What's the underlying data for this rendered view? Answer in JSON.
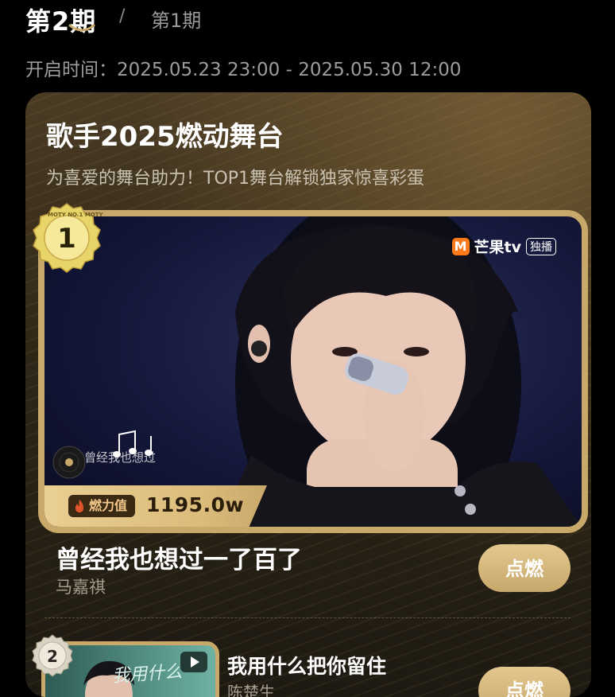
{
  "tabs": {
    "active": "第2期",
    "separator": "/",
    "other": "第1期"
  },
  "open_time": {
    "label": "开启时间：",
    "value": "2025.05.23 23:00 - 2025.05.30 12:00"
  },
  "card": {
    "title": "歌手2025燃动舞台",
    "subtitle": "为喜爱的舞台助力！TOP1舞台解锁独家惊喜彩蛋"
  },
  "featured": {
    "rank": "1",
    "medal_text": "MOTY NO.1 MOTY",
    "broadcaster": "芒果tv",
    "broadcaster_mark": "M",
    "broadcast_tag": "独播",
    "lyric": "曾经我也想过",
    "heat_label": "燃力值",
    "heat_value": "1195.0w",
    "song_title": "曾经我也想过一了百了",
    "artist": "马嘉祺",
    "button_label": "点燃"
  },
  "second": {
    "rank": "2",
    "thumb_text": "我用什么",
    "song_title": "我用什么把你留住",
    "artist": "陈楚生",
    "button_label": "点燃"
  },
  "colors": {
    "gold": "#c9a96a",
    "flame": "#e2552b",
    "card_bg": "#2e2616"
  },
  "icons": [
    "play-icon",
    "flame-icon",
    "vinyl-icon",
    "music-note-icon",
    "medal-icon"
  ]
}
